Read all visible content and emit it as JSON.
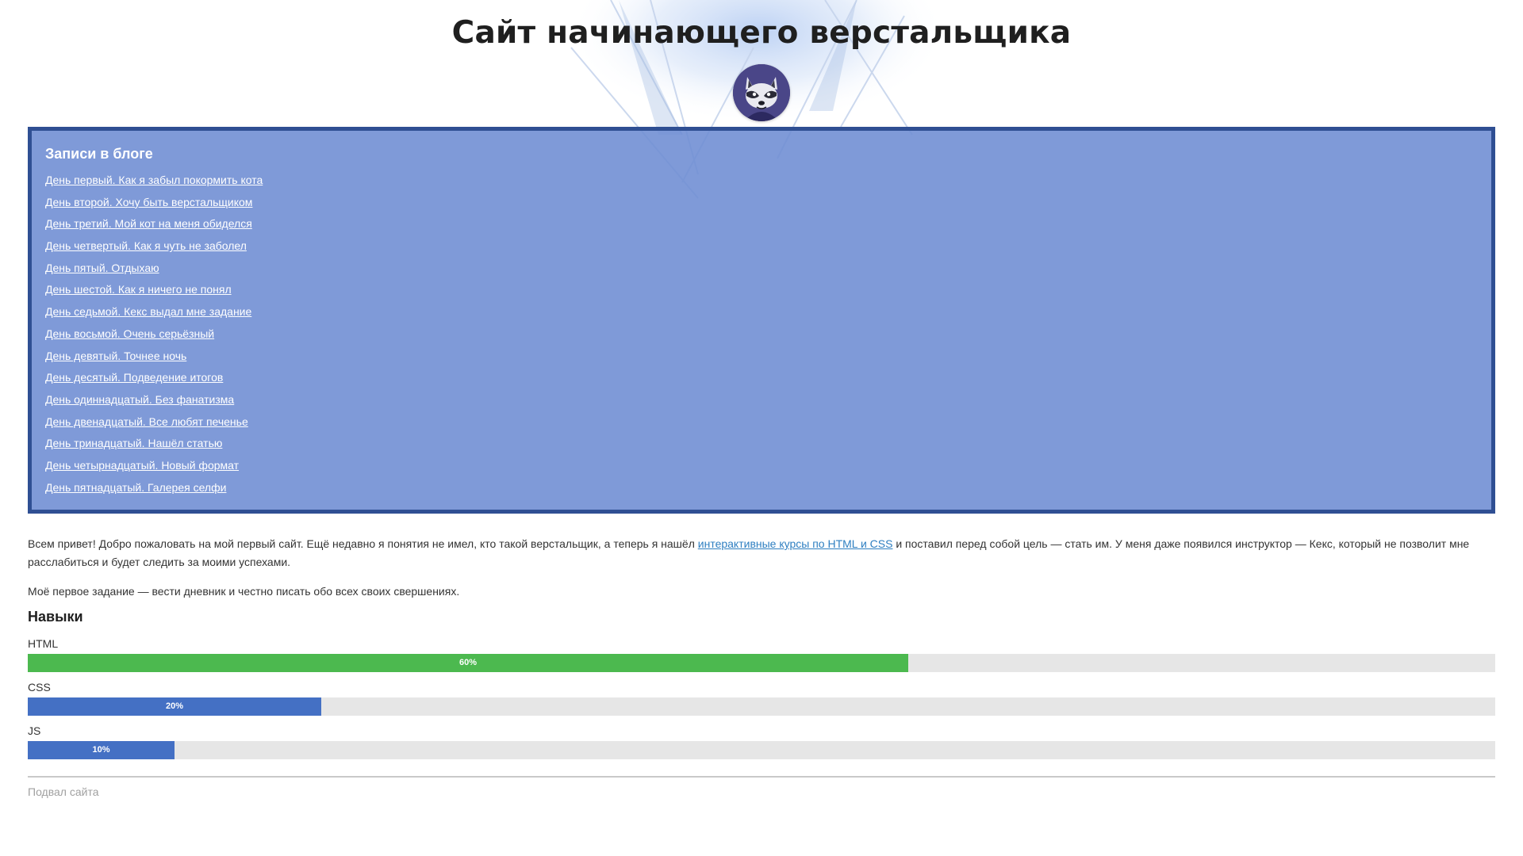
{
  "header": {
    "title": "Сайт начинающего верстальщика",
    "avatar_icon": "raccoon-avatar-icon"
  },
  "blog": {
    "title": "Записи в блоге",
    "entries": [
      "День первый. Как я забыл покормить кота",
      "День второй. Хочу быть верстальщиком",
      "День третий. Мой кот на меня обиделся",
      "День четвертый. Как я чуть не заболел",
      "День пятый. Отдыхаю",
      "День шестой. Как я ничего не понял",
      "День седьмой. Кекс выдал мне задание",
      "День восьмой. Очень серьёзный",
      "День девятый. Точнее ночь",
      "День десятый. Подведение итогов",
      "День одиннадцатый. Без фанатизма",
      "День двенадцатый. Все любят печенье",
      "День тринадцатый. Нашёл статью",
      "День четырнадцатый. Новый формат",
      "День пятнадцатый. Галерея селфи"
    ]
  },
  "intro": {
    "p1_before": "Всем привет! Добро пожаловать на мой первый сайт. Ещё недавно я понятия не имел, кто такой верстальщик, а теперь я нашёл ",
    "p1_link": "интерактивные курсы по HTML и CSS",
    "p1_after": " и поставил перед собой цель — стать им. У меня даже появился инструктор — Кекс, который не позволит мне расслабиться и будет следить за моими успехами.",
    "p2": "Моё первое задание — вести дневник и честно писать обо всех своих свершениях."
  },
  "skills": {
    "title": "Навыки",
    "items": [
      {
        "name": "HTML",
        "label": "60%",
        "value": 0.6,
        "color": "#4cb94f"
      },
      {
        "name": "CSS",
        "label": "20%",
        "value": 0.2,
        "color": "#4470c4"
      },
      {
        "name": "JS",
        "label": "10%",
        "value": 0.1,
        "color": "#4470c4"
      }
    ]
  },
  "footer": {
    "text": "Подвал сайта"
  },
  "colors": {
    "blog_bg": "#6d8cd3",
    "blog_border": "#2f4f93",
    "link": "#2e7fc1",
    "track": "#e6e6e6"
  }
}
